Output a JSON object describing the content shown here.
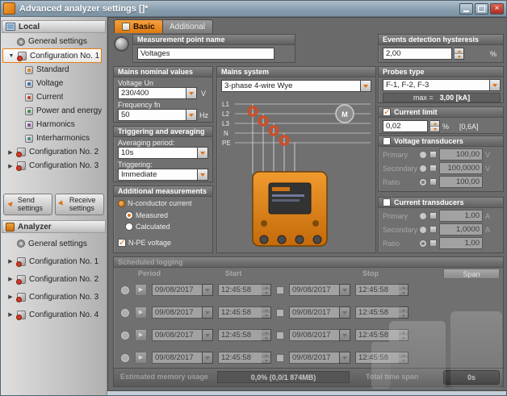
{
  "window": {
    "title": "Advanced analyzer settings []*"
  },
  "tabs": {
    "basic": "Basic",
    "additional": "Additional"
  },
  "sidebar": {
    "local": {
      "header": "Local",
      "items": [
        {
          "label": "General settings"
        },
        {
          "label": "Configuration No. 1"
        },
        {
          "label": "Standard"
        },
        {
          "label": "Voltage"
        },
        {
          "label": "Current"
        },
        {
          "label": "Power and energy"
        },
        {
          "label": "Harmonics"
        },
        {
          "label": "Interharmonics"
        },
        {
          "label": "Configuration No. 2"
        },
        {
          "label": "Configuration No. 3"
        }
      ]
    },
    "send_button": {
      "label": "Send settings"
    },
    "receive_button": {
      "label": "Receive settings"
    },
    "analyzer": {
      "header": "Analyzer",
      "items": [
        {
          "label": "General settings"
        },
        {
          "label": "Configuration No. 1"
        },
        {
          "label": "Configuration No. 2"
        },
        {
          "label": "Configuration No. 3"
        },
        {
          "label": "Configuration No. 4"
        }
      ]
    }
  },
  "measurement_point": {
    "title": "Measurement point name",
    "value": "Voltages"
  },
  "events_hysteresis": {
    "title": "Events detection hysteresis",
    "value": "2,00",
    "unit": "%"
  },
  "mains_nominal": {
    "title": "Mains nominal values",
    "voltage_label": "Voltage Un",
    "voltage_value": "230/400",
    "voltage_unit": "V",
    "frequency_label": "Frequency fn",
    "frequency_value": "50",
    "frequency_unit": "Hz"
  },
  "mains_system": {
    "title": "Mains system",
    "value": "3-phase 4-wire Wye",
    "line_labels": [
      "L1",
      "L2",
      "L3",
      "N",
      "PE"
    ],
    "motor_label": "M"
  },
  "probes": {
    "title": "Probes type",
    "value": "F-1, F-2, F-3",
    "max_label": "max =",
    "max_value": "3,00  [kA]"
  },
  "current_limit": {
    "title": "Current limit",
    "checked": true,
    "value": "0,02",
    "unit": "%",
    "range": "[0,6A]"
  },
  "triggering": {
    "title": "Triggering and averaging",
    "averaging_label": "Averaging period:",
    "averaging_value": "10s",
    "trigger_label": "Triggering:",
    "trigger_value": "Immediate"
  },
  "additional_measurements": {
    "title": "Additional measurements",
    "n_conductor_label": "N-conductor current",
    "measured_label": "Measured",
    "measured_selected": true,
    "calculated_label": "Calculated",
    "npe_label": "N-PE voltage",
    "npe_checked": true
  },
  "voltage_transducers": {
    "title": "Voltage transducers",
    "checked": false,
    "rows": [
      {
        "label": "Primary",
        "value": "100,00",
        "unit": "V"
      },
      {
        "label": "Secondary",
        "value": "100,0000",
        "unit": "V"
      },
      {
        "label": "Ratio",
        "value": "100,00",
        "unit": ""
      }
    ]
  },
  "current_transducers": {
    "title": "Current transducers",
    "checked": false,
    "rows": [
      {
        "label": "Primary",
        "value": "1,00",
        "unit": "A"
      },
      {
        "label": "Secondary",
        "value": "1,0000",
        "unit": "A"
      },
      {
        "label": "Ratio",
        "value": "1,00",
        "unit": ""
      }
    ]
  },
  "scheduled_logging": {
    "title": "Scheduled logging",
    "enabled": false,
    "headers": {
      "period": "Period",
      "start": "Start",
      "stop": "Stop",
      "span": "Span"
    },
    "rows": [
      {
        "start_date": "09/08/2017",
        "start_time": "12:45:58",
        "stop_date": "09/08/2017",
        "stop_time": "12:45:58"
      },
      {
        "start_date": "09/08/2017",
        "start_time": "12:45:58",
        "stop_date": "09/08/2017",
        "stop_time": "12:45:58"
      },
      {
        "start_date": "09/08/2017",
        "start_time": "12:45:58",
        "stop_date": "09/08/2017",
        "stop_time": "12:45:58"
      },
      {
        "start_date": "09/08/2017",
        "start_time": "12:45:58",
        "stop_date": "09/08/2017",
        "stop_time": "12:45:58"
      }
    ],
    "memory_label": "Estimated memory usage",
    "memory_value": "0,0% (0,0/1 874MB)",
    "total_span_label": "Total time span",
    "total_span_value": "0s"
  },
  "colors": {
    "accent": "#e0700e",
    "selection": "#e87e12",
    "close_button": "#a92e20"
  }
}
